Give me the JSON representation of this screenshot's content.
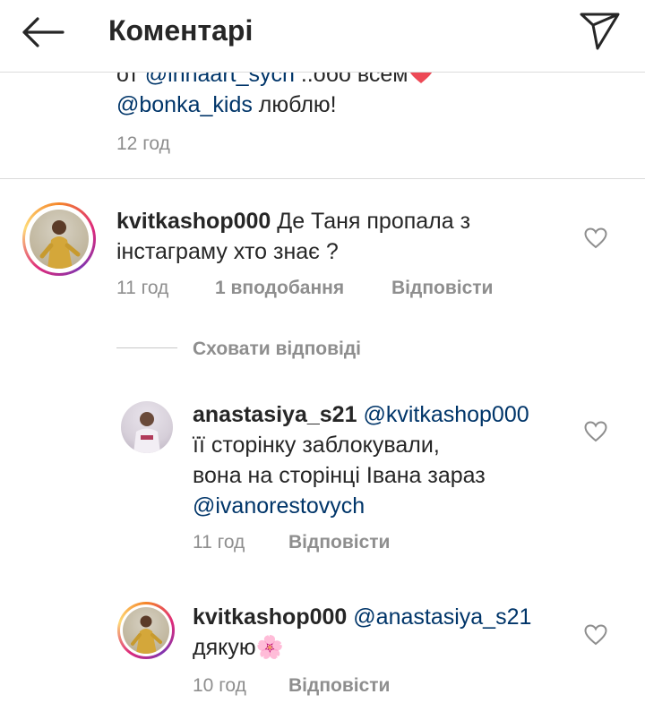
{
  "header": {
    "title": "Коментарі"
  },
  "previous_comment": {
    "line1_prefix": "от ",
    "line1_mention": "@innaart_sych",
    "line1_rest": " ..обо всем",
    "line2_mention": "@bonka_kids",
    "line2_rest": " люблю!",
    "time": "12 год"
  },
  "comment": {
    "username": "kvitkashop000",
    "text": " Де Таня пропала з інстаграму хто знає ?",
    "time": "11 год",
    "likes": "1 вподобання",
    "reply_label": "Відповісти"
  },
  "hide_replies_label": "Сховати відповіді",
  "replies": [
    {
      "username": "anastasiya_s21",
      "mention": "@kvitkashop000",
      "text_line1": "її сторінку заблокували,",
      "text_line2": "вона на сторінці Івана зараз",
      "mention2": "@ivanorestovych",
      "time": "11 год",
      "reply_label": "Відповісти"
    },
    {
      "username": "kvitkashop000",
      "mention": "@anastasiya_s21",
      "text": "дякую",
      "emoji": "🌸",
      "time": "10 год",
      "reply_label": "Відповісти"
    }
  ],
  "colors": {
    "mention": "#003569",
    "meta": "#8e8e8e",
    "divider": "#dbdbdb",
    "heart_emoji": "#ed4956"
  },
  "icons": {
    "back": "back-arrow-icon",
    "send": "direct-send-icon",
    "like": "heart-outline-icon"
  }
}
